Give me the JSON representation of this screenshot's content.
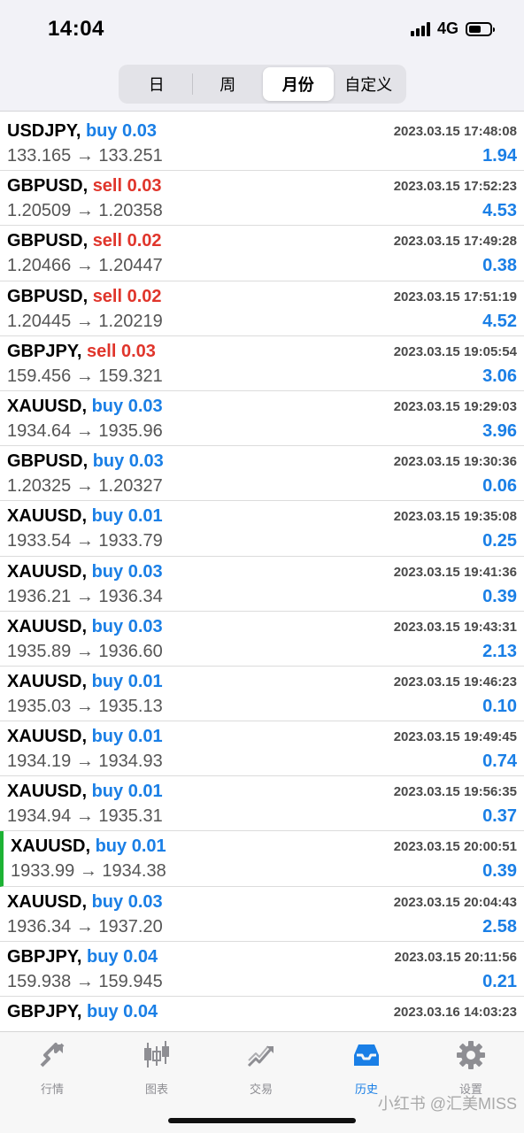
{
  "status_bar": {
    "time": "14:04",
    "network": "4G"
  },
  "segments": [
    {
      "label": "日",
      "active": false
    },
    {
      "label": "周",
      "active": false
    },
    {
      "label": "月份",
      "active": true
    },
    {
      "label": "自定义",
      "active": false
    }
  ],
  "trades": [
    {
      "symbol": "USDJPY,",
      "action": "buy 0.03",
      "side": "buy",
      "time": "2023.03.15 17:48:08",
      "prices": "133.165 → 133.251",
      "profit": "1.94"
    },
    {
      "symbol": "GBPUSD,",
      "action": "sell 0.03",
      "side": "sell",
      "time": "2023.03.15 17:52:23",
      "prices": "1.20509 → 1.20358",
      "profit": "4.53"
    },
    {
      "symbol": "GBPUSD,",
      "action": "sell 0.02",
      "side": "sell",
      "time": "2023.03.15 17:49:28",
      "prices": "1.20466 → 1.20447",
      "profit": "0.38"
    },
    {
      "symbol": "GBPUSD,",
      "action": "sell 0.02",
      "side": "sell",
      "time": "2023.03.15 17:51:19",
      "prices": "1.20445 → 1.20219",
      "profit": "4.52"
    },
    {
      "symbol": "GBPJPY,",
      "action": "sell 0.03",
      "side": "sell",
      "time": "2023.03.15 19:05:54",
      "prices": "159.456 → 159.321",
      "profit": "3.06"
    },
    {
      "symbol": "XAUUSD,",
      "action": "buy 0.03",
      "side": "buy",
      "time": "2023.03.15 19:29:03",
      "prices": "1934.64 → 1935.96",
      "profit": "3.96"
    },
    {
      "symbol": "GBPUSD,",
      "action": "buy 0.03",
      "side": "buy",
      "time": "2023.03.15 19:30:36",
      "prices": "1.20325 → 1.20327",
      "profit": "0.06"
    },
    {
      "symbol": "XAUUSD,",
      "action": "buy 0.01",
      "side": "buy",
      "time": "2023.03.15 19:35:08",
      "prices": "1933.54 → 1933.79",
      "profit": "0.25"
    },
    {
      "symbol": "XAUUSD,",
      "action": "buy 0.03",
      "side": "buy",
      "time": "2023.03.15 19:41:36",
      "prices": "1936.21 → 1936.34",
      "profit": "0.39"
    },
    {
      "symbol": "XAUUSD,",
      "action": "buy 0.03",
      "side": "buy",
      "time": "2023.03.15 19:43:31",
      "prices": "1935.89 → 1936.60",
      "profit": "2.13"
    },
    {
      "symbol": "XAUUSD,",
      "action": "buy 0.01",
      "side": "buy",
      "time": "2023.03.15 19:46:23",
      "prices": "1935.03 → 1935.13",
      "profit": "0.10"
    },
    {
      "symbol": "XAUUSD,",
      "action": "buy 0.01",
      "side": "buy",
      "time": "2023.03.15 19:49:45",
      "prices": "1934.19 → 1934.93",
      "profit": "0.74"
    },
    {
      "symbol": "XAUUSD,",
      "action": "buy 0.01",
      "side": "buy",
      "time": "2023.03.15 19:56:35",
      "prices": "1934.94 → 1935.31",
      "profit": "0.37"
    },
    {
      "symbol": "XAUUSD,",
      "action": "buy 0.01",
      "side": "buy",
      "time": "2023.03.15 20:00:51",
      "prices": "1933.99 → 1934.38",
      "profit": "0.39",
      "marked": true
    },
    {
      "symbol": "XAUUSD,",
      "action": "buy 0.03",
      "side": "buy",
      "time": "2023.03.15 20:04:43",
      "prices": "1936.34 → 1937.20",
      "profit": "2.58"
    },
    {
      "symbol": "GBPJPY,",
      "action": "buy 0.04",
      "side": "buy",
      "time": "2023.03.15 20:11:56",
      "prices": "159.938 → 159.945",
      "profit": "0.21"
    },
    {
      "symbol": "GBPJPY,",
      "action": "buy 0.04",
      "side": "buy",
      "time": "2023.03.16 14:03:23",
      "prices": "",
      "profit": ""
    }
  ],
  "tabs": [
    {
      "label": "行情",
      "icon": "quotes-arrow-icon",
      "active": false
    },
    {
      "label": "图表",
      "icon": "candlestick-chart-icon",
      "active": false
    },
    {
      "label": "交易",
      "icon": "trade-chart-icon",
      "active": false
    },
    {
      "label": "历史",
      "icon": "history-inbox-icon",
      "active": true
    },
    {
      "label": "设置",
      "icon": "gear-icon",
      "active": false
    }
  ],
  "watermark": "小红书 @汇美MISS",
  "colors": {
    "buy": "#1a7fe6",
    "sell": "#e0352b",
    "accent": "#1a7fe6",
    "marker": "#1db234"
  }
}
